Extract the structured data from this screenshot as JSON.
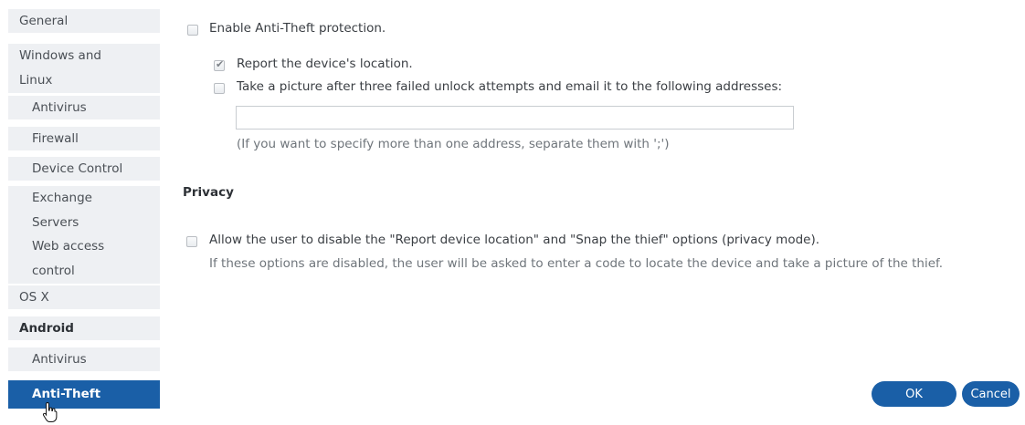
{
  "sidebar": {
    "items": [
      {
        "label": "General"
      },
      {
        "line1": "Windows and",
        "line2": "Linux"
      },
      {
        "label": "Antivirus"
      },
      {
        "label": "Firewall"
      },
      {
        "label": "Device Control"
      },
      {
        "line1": "Exchange",
        "line2": "Servers"
      },
      {
        "line1": "Web access",
        "line2": "control"
      },
      {
        "label": "OS X"
      },
      {
        "label": "Android"
      },
      {
        "label": "Antivirus"
      },
      {
        "label": "Anti-Theft"
      }
    ],
    "selected": "Anti-Theft"
  },
  "anti_theft": {
    "enable_label": "Enable Anti-Theft protection.",
    "enable_checked": false,
    "report_location_label": "Report the device's location.",
    "report_location_checked": true,
    "take_picture_label": "Take a picture after three failed unlock attempts and email it to the following addresses:",
    "take_picture_checked": false,
    "email_value": "",
    "email_hint": "(If you want to specify more than one address, separate them with ';')"
  },
  "privacy": {
    "title": "Privacy",
    "allow_label": "Allow the user to disable the \"Report device location\" and \"Snap the thief\" options (privacy mode).",
    "allow_checked": false,
    "note": "If these options are disabled, the user will be asked to enter a code to locate the device and take a picture of the thief."
  },
  "buttons": {
    "ok_label": "OK",
    "cancel_label": "Cancel"
  },
  "colors": {
    "accent": "#1a5fa7",
    "sidebar_bg": "#eef0f3"
  }
}
